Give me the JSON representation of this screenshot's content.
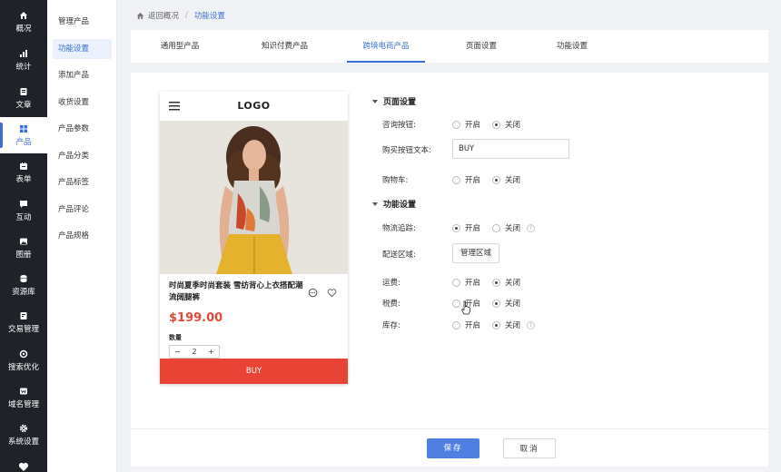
{
  "sidebar": {
    "items": [
      {
        "label": "概况",
        "icon": "home-icon"
      },
      {
        "label": "统计",
        "icon": "chart-icon"
      },
      {
        "label": "文章",
        "icon": "document-icon"
      },
      {
        "label": "产品",
        "icon": "grid-icon",
        "active": true
      },
      {
        "label": "表单",
        "icon": "calendar-icon"
      },
      {
        "label": "互动",
        "icon": "chat-icon"
      },
      {
        "label": "图册",
        "icon": "image-icon"
      },
      {
        "label": "资源库",
        "icon": "database-icon"
      },
      {
        "label": "交易管理",
        "icon": "wallet-icon"
      },
      {
        "label": "搜索优化",
        "icon": "search-icon"
      },
      {
        "label": "域名管理",
        "icon": "globe-icon"
      },
      {
        "label": "系统设置",
        "icon": "gear-icon"
      }
    ]
  },
  "submenu": {
    "items": [
      {
        "label": "管理产品"
      },
      {
        "label": "功能设置",
        "active": true
      },
      {
        "label": "添加产品"
      },
      {
        "label": "收货设置"
      },
      {
        "label": "产品参数"
      },
      {
        "label": "产品分类"
      },
      {
        "label": "产品标签"
      },
      {
        "label": "产品评论"
      },
      {
        "label": "产品规格"
      }
    ]
  },
  "breadcrumb": {
    "back": "返回概况",
    "sep": "/",
    "current": "功能设置"
  },
  "tabs": [
    {
      "label": "通用型产品"
    },
    {
      "label": "知识付费产品"
    },
    {
      "label": "跨境电商产品",
      "active": true
    },
    {
      "label": "页面设置"
    },
    {
      "label": "功能设置"
    }
  ],
  "preview": {
    "logo": "LOGO",
    "product_title": "时尚夏季时尚套装 雪纺背心上衣搭配潮流阔腿裤",
    "price": "$199.00",
    "qty_label": "数量",
    "qty_minus": "−",
    "qty_value": "2",
    "qty_plus": "+",
    "buy_label": "BUY"
  },
  "page_settings": {
    "title": "页面设置",
    "consult_label": "咨询按钮:",
    "buy_text_label": "购买按钮文本:",
    "buy_text_value": "BUY",
    "cart_label": "购物车:"
  },
  "feature_settings": {
    "title": "功能设置",
    "tracking_label": "物流追踪:",
    "region_label": "配送区域:",
    "region_button": "管理区域",
    "shipping_label": "运费:",
    "tax_label": "税费:",
    "stock_label": "库存:"
  },
  "options": {
    "on": "开启",
    "off": "关闭",
    "help": "?"
  },
  "footer": {
    "save": "保存",
    "cancel": "取消"
  },
  "colors": {
    "accent": "#3b6fd8",
    "buy": "#e94335",
    "price": "#e04a3a",
    "sidebar": "#1f2329"
  }
}
